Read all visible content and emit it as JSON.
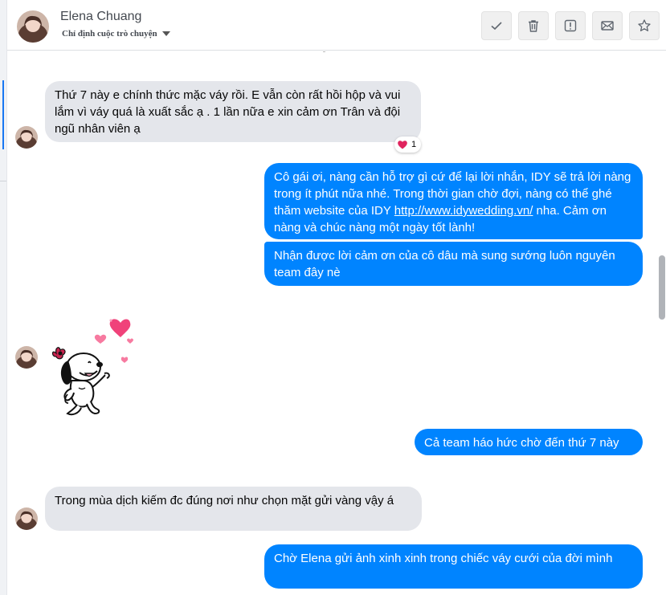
{
  "header": {
    "name": "Elena Chuang",
    "subtitle": "Chỉ định cuộc trò chuyện",
    "actions": [
      {
        "icon": "checkmark-icon"
      },
      {
        "icon": "trash-icon"
      },
      {
        "icon": "alert-icon"
      },
      {
        "icon": "envelope-icon"
      },
      {
        "icon": "star-icon"
      }
    ]
  },
  "messages": [
    {
      "from": "contact",
      "text": "Thứ 7 này e chính thức mặc váy rồi. E vẫn còn rất hồi hộp và vui lắm vì váy quá là xuất sắc ạ . 1 lần nữa e xin cảm ơn Trân và đội ngũ nhân viên ạ",
      "reaction": {
        "icon": "heart-icon",
        "count": "1"
      }
    },
    {
      "from": "page",
      "text_before": "Cô gái ơi, nàng cần hỗ trợ gì cứ để lại lời nhắn, IDY sẽ trả lời nàng trong ít phút nữa nhé. Trong thời gian chờ đợi, nàng có thể ghé thăm website của IDY ",
      "link": "http://www.idywedding.vn/",
      "text_after": "  nha. Cảm ơn nàng và chúc nàng một ngày tốt lành!"
    },
    {
      "from": "page",
      "text": "Nhận được lời cảm ơn của cô dâu mà sung sướng luôn nguyên team đây nè"
    },
    {
      "from": "contact",
      "sticker": "snoopy-hearts-sticker"
    },
    {
      "from": "page",
      "text": "Cả team háo hức chờ đến thứ 7 này"
    },
    {
      "from": "contact",
      "text": "Trong mùa dịch kiếm đc đúng nơi như chọn mặt gửi vàng vậy á"
    },
    {
      "from": "page",
      "text": "Chờ Elena gửi ảnh xinh xinh trong chiếc váy cưới của đời mình"
    }
  ],
  "colors": {
    "outgoing_bubble": "#0084ff",
    "incoming_bubble": "#e4e6eb",
    "reaction_heart": "#e0245e",
    "sticker_hearts": "#f0427a"
  }
}
